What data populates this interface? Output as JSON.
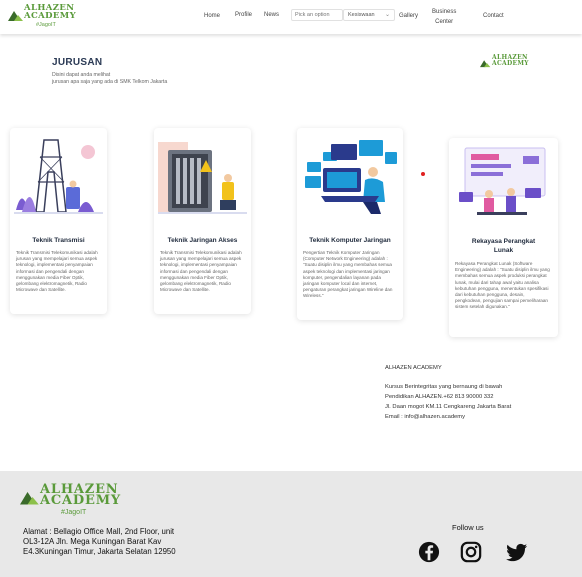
{
  "nav": {
    "logo_name": "ALHAZEN ACADEMY",
    "logo_tagline": "#JagoIT",
    "links": [
      "Home",
      "Profile",
      "News"
    ],
    "search_placeholder": "Pick an option",
    "select_value": "Kesiswaan",
    "gallery": "Gallery",
    "business_center_line1": "Business",
    "business_center_line2": "Center",
    "contact": "Contact"
  },
  "section": {
    "title": "JURUSAN",
    "desc_line1": "Disini dapat anda melihat",
    "desc_line2": "jurusan apa saja yang ada di SMK Telkom Jakarta",
    "logo_name": "ALHAZEN ACADEMY"
  },
  "cards": [
    {
      "title": "Teknik Transmisi",
      "text": "Teknik Transmisi Telekomunikasi adalah jurusan yang mempelajari semua aspek teknologi, implementasi penyampaian informasi dan pengendali dengan menggunakan media Fiber Optik, gelombang elektromagnetik, Radio Microwave dan Satellite."
    },
    {
      "title": "Teknik Jaringan Akses",
      "text": "Teknik Transmisi Telekomunikasi adalah jurusan yang mempelajari semua aspek teknologi, implementasi penyampaian informasi dan pengendali dengan menggunakan media Fiber Optik, gelombang elektromagnetik, Radio Microwave dan Satellite."
    },
    {
      "title": "Teknik Komputer Jaringan",
      "text": "Pengertian Teknik Komputer Jaringan (Computer Network Engineering) adalah : \"Suatu disiplin ilmu yang membahas semua aspek teknologi dan implementasi jaringan komputer, pengendalian layanan pada jaringan komputer local dan internet, pengaturan perangkat jaringan Wireline dan Wireless.\""
    },
    {
      "title_line1": "Rekayasa Perangkat",
      "title_line2": "Lunak",
      "text": "Rekayasa Perangkat Lunak (Software Engineering) adalah : \"Suatu disiplin ilmu yang membahas semua aspek produksi perangkat lunak, mulai dari tahap awal yaitu analisa kebutuhan pengguna, menentukan spesifikasi dari kebutuhan pengguna, desain, pengkodean, pengujian sampai pemeliharaan sistem setelah digunakan.\""
    }
  ],
  "contact": {
    "heading": "ALHAZEN ACADEMY",
    "line1": "Kursus Berintegritas yang bernaung di bawah",
    "line2": "Pendidikan ALHAZEN.+62 813 90000 332",
    "line3": "Jl. Daan mogot KM.11 Cengkareng Jakarta Barat",
    "line4": "Email : info@alhazen.academy"
  },
  "footer": {
    "logo_name": "ALHAZEN ACADEMY",
    "logo_tagline": "#JagoIT",
    "address_line1": "Alamat : Bellagio Office Mall, 2nd Floor, unit",
    "address_line2": "OL3-12A Jln. Mega Kuningan Barat Kav",
    "address_line3": "E4.3Kuningan Timur, Jakarta Selatan 12950",
    "follow_us": "Follow us",
    "social_icons": [
      "facebook-icon",
      "instagram-icon",
      "twitter-icon"
    ]
  },
  "colors": {
    "brand_green": "#5a9a3a",
    "title_navy": "#2b3a55",
    "footer_bg": "#e8e8e8",
    "dot_red": "#e02020"
  }
}
